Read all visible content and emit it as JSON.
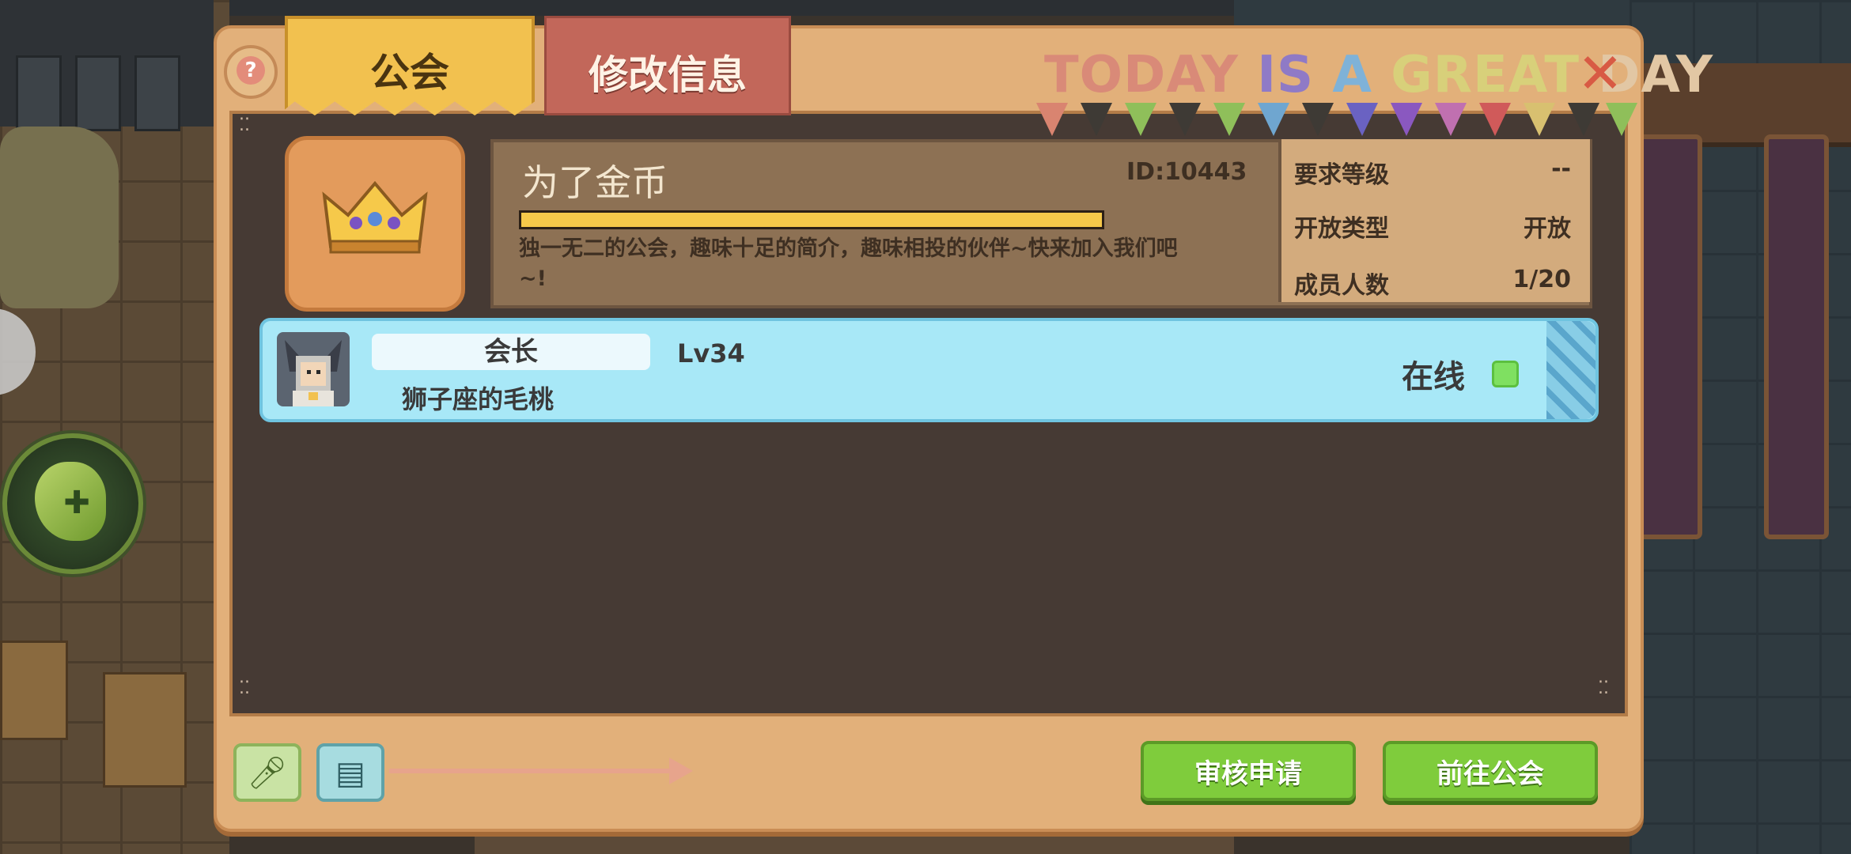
{
  "tabs": {
    "guild": "公会",
    "edit_info": "修改信息"
  },
  "banner": {
    "words": [
      {
        "text": "TODAY",
        "color": "#d98a78"
      },
      {
        "text": "IS",
        "color": "#8f7ac6"
      },
      {
        "text": "A",
        "color": "#7fb2d8"
      },
      {
        "text": "GREAT",
        "color": "#d8d07a"
      },
      {
        "text": "DAY",
        "color": "#e2c7a4"
      }
    ]
  },
  "guild": {
    "name": "为了金币",
    "id": "ID:10443",
    "xp_fraction": 1.0,
    "description": "独一无二的公会，趣味十足的简介，趣味相投的伙伴~快来加入我们吧~!"
  },
  "stats": [
    {
      "label": "要求等级",
      "value": "--"
    },
    {
      "label": "开放类型",
      "value": "开放"
    },
    {
      "label": "成员人数",
      "value": "1/20"
    }
  ],
  "member": {
    "role": "会长",
    "level": "Lv34",
    "name": "狮子座的毛桃",
    "status": "在线",
    "status_color": "#7fe061"
  },
  "buttons": {
    "review": "审核申请",
    "goto_guild": "前往公会"
  },
  "icons": {
    "help": "help-icon",
    "close": "close-icon",
    "mic": "microphone-icon",
    "book": "book-icon",
    "skill": "skill-icon"
  }
}
